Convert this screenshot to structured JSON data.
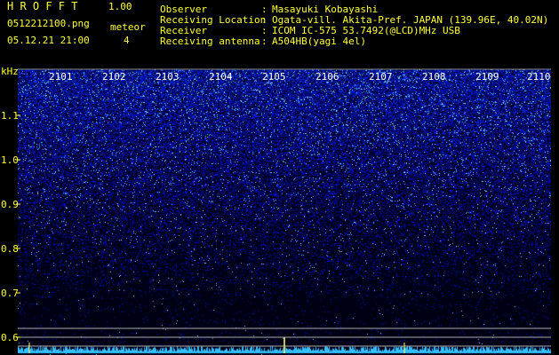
{
  "app": {
    "title": "H R O F F T",
    "version": "1.00"
  },
  "file": {
    "name": "0512212100.png",
    "datetime": "05.12.21 21:00"
  },
  "meteor": {
    "label": "meteor",
    "count": "4"
  },
  "info": [
    {
      "label": "Observer",
      "colon": ":",
      "value": "Masayuki Kobayashi"
    },
    {
      "label": "Receiving Location",
      "colon": ":",
      "value": "Ogata-vill. Akita-Pref. JAPAN (139.96E, 40.02N)"
    },
    {
      "label": "Receiver",
      "colon": ":",
      "value": "ICOM IC-575 53.7492(@LCD)MHz USB"
    },
    {
      "label": "Receiving antenna",
      "colon": ":",
      "value": "A504HB(yagi 4el)"
    }
  ],
  "axis": {
    "unit": "kHz",
    "labels": [
      "1.1",
      "1.0",
      "0.9",
      "0.8",
      "0.7",
      "0.6"
    ]
  },
  "time_ticks": [
    "2101",
    "2102",
    "2103",
    "2104",
    "2105",
    "2106",
    "2107",
    "2108",
    "2109",
    "2110"
  ],
  "colors": {
    "yellow": "#ffff33",
    "white": "#ffffff",
    "background": "#000000"
  }
}
